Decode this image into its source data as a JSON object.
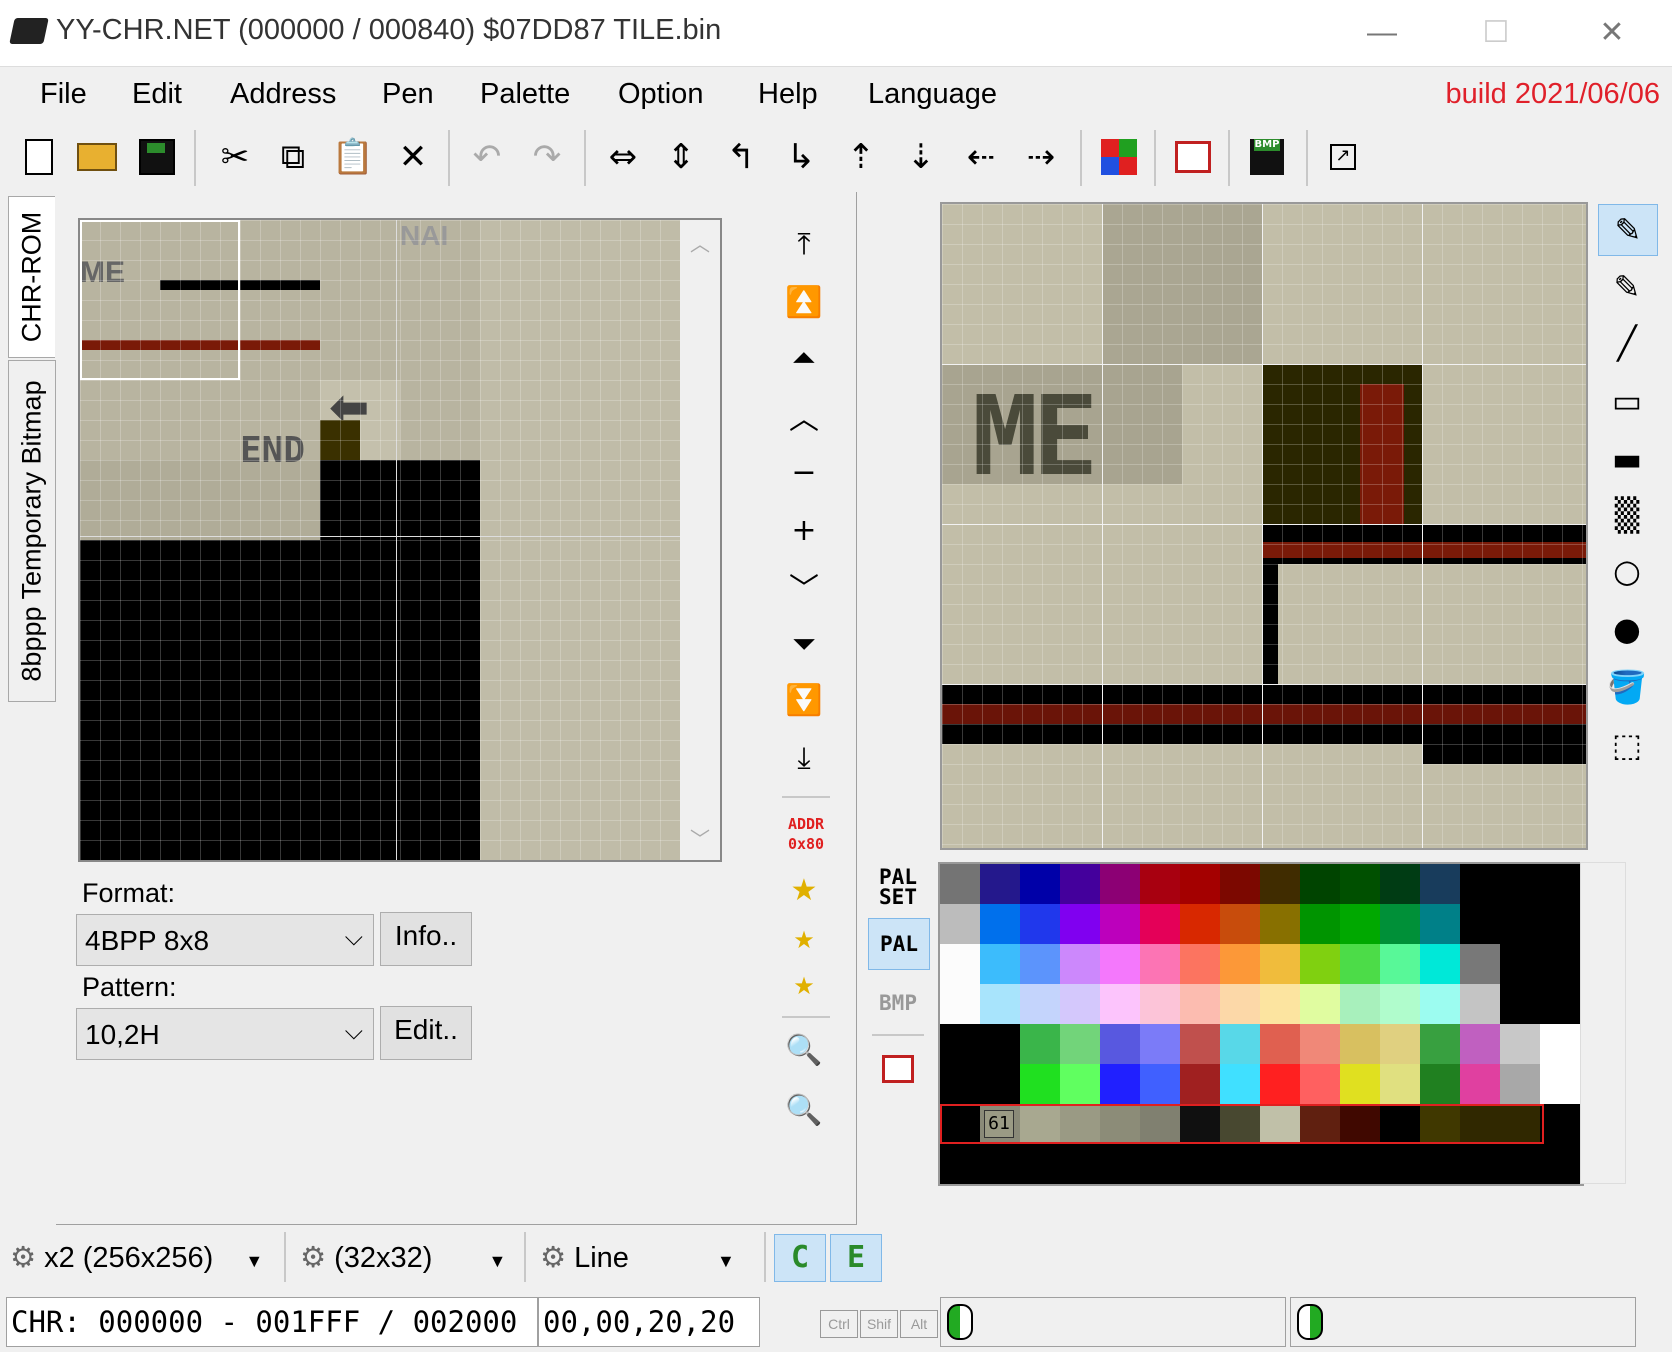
{
  "window": {
    "title": "YY-CHR.NET (000000 / 000840) $07DD87 TILE.bin",
    "minimize": "—",
    "maximize": "☐",
    "close": "✕"
  },
  "menu": {
    "items": [
      "File",
      "Edit",
      "Address",
      "Pen",
      "Palette",
      "Option",
      "Help",
      "Language"
    ],
    "build": "build 2021/06/06"
  },
  "toolbar": {
    "icons": [
      "new-file-icon",
      "open-folder-icon",
      "save-icon",
      "cut-icon",
      "copy-icon",
      "paste-icon",
      "delete-icon",
      "undo-icon",
      "redo-icon",
      "flip-horizontal-icon",
      "flip-vertical-icon",
      "rotate-left-icon",
      "rotate-right-icon",
      "shift-up-icon",
      "shift-down-icon",
      "shift-left-icon",
      "shift-right-icon",
      "palette-import-icon",
      "palette-export-icon",
      "save-bmp-icon",
      "popout-icon"
    ],
    "bmp_badge": "BMP"
  },
  "tabs": {
    "chr_rom": "CHR-ROM",
    "temp_bitmap": "8bppp Temporary Bitmap"
  },
  "nav": {
    "addr_label": "ADDR",
    "addr_value": "0x80",
    "minus": "−",
    "plus": "+"
  },
  "format": {
    "label": "Format:",
    "value": "4BPP 8x8",
    "info_button": "Info.."
  },
  "pattern": {
    "label": "Pattern:",
    "value": "10,2H",
    "edit_button": "Edit.."
  },
  "palette_side": {
    "pal_set": "PAL SET",
    "pal": "PAL",
    "bmp": "BMP"
  },
  "palette": {
    "selected_index": "61",
    "rows": [
      [
        "#747474",
        "#24188c",
        "#0000a8",
        "#44009c",
        "#8c0074",
        "#a80010",
        "#a40000",
        "#7c0800",
        "#402c00",
        "#004400",
        "#005000",
        "#003c14",
        "#183c5c",
        "#000000",
        "#000000"
      ],
      [
        "#bcbcbc",
        "#0070ec",
        "#2038ec",
        "#8000f0",
        "#bc00bc",
        "#e40058",
        "#d82800",
        "#c84c0c",
        "#887000",
        "#009400",
        "#00a800",
        "#009038",
        "#008088",
        "#000000",
        "#000000"
      ],
      [
        "#fcfcfc",
        "#3cbcfc",
        "#5c94fc",
        "#cc88fc",
        "#f478fc",
        "#fc74b4",
        "#fc7460",
        "#fc9838",
        "#f0bc3c",
        "#80d010",
        "#4cdc48",
        "#58f898",
        "#00e8d8",
        "#787878",
        "#000000"
      ],
      [
        "#fcfcfc",
        "#a8e4fc",
        "#c4d4fc",
        "#d4c8fc",
        "#fcc4fc",
        "#fcc4d8",
        "#fcbcb0",
        "#fcd8a8",
        "#fce4a0",
        "#e0fca0",
        "#a8f0bc",
        "#b0fccc",
        "#9cfcf0",
        "#c4c4c4",
        "#000000"
      ],
      [
        "#000000",
        "#000000",
        "#3ab54a",
        "#72d47a",
        "#5858e0",
        "#7b7bf8",
        "#c0504d",
        "#58d8e8",
        "#e06050",
        "#f08878",
        "#d8c060",
        "#e0d080",
        "#38a040",
        "#c060c0",
        "#c8c8c8",
        "#ffffff"
      ],
      [
        "#000000",
        "#000000",
        "#20e020",
        "#60ff60",
        "#2020ff",
        "#4060ff",
        "#a02020",
        "#40e0ff",
        "#ff2020",
        "#ff6060",
        "#e0e020",
        "#e0e080",
        "#208020",
        "#e040a0",
        "#a8a8a8",
        "#ffffff"
      ],
      [
        "#000000",
        "#8a8a78",
        "#a8a890",
        "#9a9a84",
        "#8c8c78",
        "#808070",
        "#101010",
        "#484830",
        "#c0c0a8",
        "#602010",
        "#400800",
        "#000000",
        "#403800",
        "#302800",
        "#302800"
      ]
    ]
  },
  "bottom": {
    "zoom": "x2 (256x256)",
    "grid": "(32x32)",
    "pen": "Line",
    "c_btn": "C",
    "e_btn": "E"
  },
  "status": {
    "chr_range": "CHR: 000000 - 001FFF / 002000",
    "coords": "00,00,20,20",
    "keys": [
      "Ctrl",
      "Shif",
      "Alt"
    ]
  }
}
